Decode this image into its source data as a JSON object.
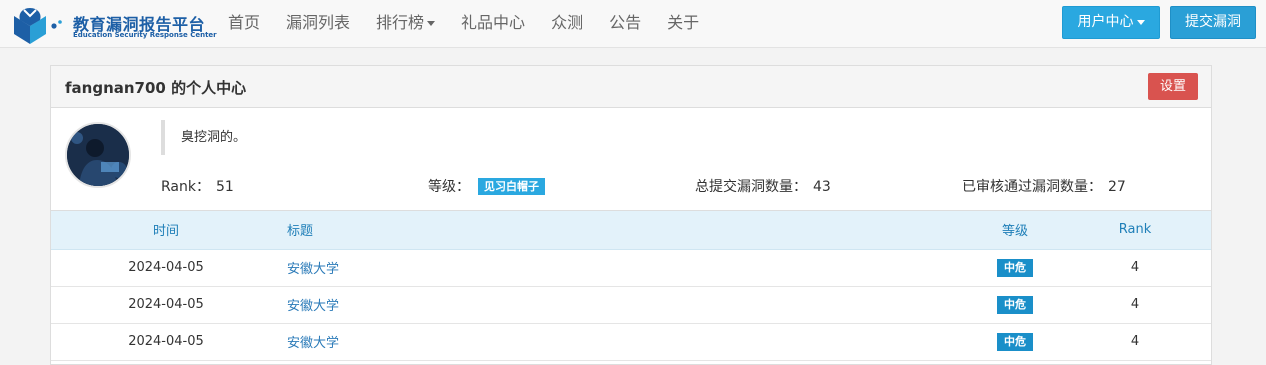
{
  "brand": {
    "title": "教育漏洞报告平台",
    "subtitle": "Education Security Response Center",
    "color": "#1d5fa6"
  },
  "nav": {
    "items": [
      {
        "label": "首页"
      },
      {
        "label": "漏洞列表"
      },
      {
        "label": "排行榜"
      },
      {
        "label": "礼品中心"
      },
      {
        "label": "众测"
      },
      {
        "label": "公告"
      },
      {
        "label": "关于"
      }
    ],
    "user_center": "用户中心",
    "submit": "提交漏洞"
  },
  "panel": {
    "title": "fangnan700 的个人中心",
    "settings": "设置"
  },
  "profile": {
    "bio": "臭挖洞的。",
    "rank_label": "Rank：",
    "rank_value": "51",
    "level_label": "等级：",
    "level_value": "见习白帽子",
    "submitted_label": "总提交漏洞数量：",
    "submitted_value": "43",
    "approved_label": "已审核通过漏洞数量：",
    "approved_value": "27"
  },
  "table": {
    "headers": {
      "time": "时间",
      "title": "标题",
      "level": "等级",
      "rank": "Rank"
    },
    "rows": [
      {
        "time": "2024-04-05",
        "title": "安徽大学",
        "level": "中危",
        "rank": "4"
      },
      {
        "time": "2024-04-05",
        "title": "安徽大学",
        "level": "中危",
        "rank": "4"
      },
      {
        "time": "2024-04-05",
        "title": "安徽大学",
        "level": "中危",
        "rank": "4"
      }
    ]
  },
  "colors": {
    "accent": "#2aa8e0",
    "danger": "#d9534f",
    "severity_medium": "#1a8fc9"
  },
  "icons": {
    "nav_dropdown": "caret-down-icon",
    "logo": "book-logo-icon"
  }
}
